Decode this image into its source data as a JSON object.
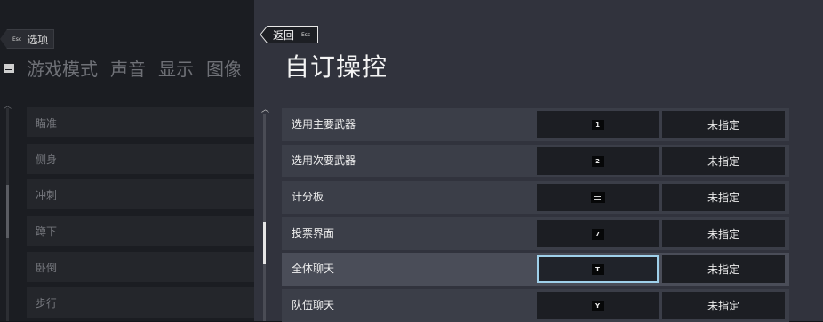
{
  "background": {
    "back": {
      "esc": "Esc",
      "label": "选项"
    },
    "tabs": [
      "游戏模式",
      "声音",
      "显示",
      "图像"
    ],
    "rows": [
      "瞄准",
      "侧身",
      "冲刺",
      "蹲下",
      "卧倒",
      "步行"
    ]
  },
  "header": {
    "back_label": "返回",
    "back_esc": "Esc",
    "title": "自订操控"
  },
  "bindings": [
    {
      "name": "选用主要武器",
      "key": "1",
      "secondary": "未指定"
    },
    {
      "name": "选用次要武器",
      "key": "2",
      "secondary": "未指定"
    },
    {
      "name": "计分板",
      "key": "",
      "key_icon": "tab-key-icon",
      "secondary": "未指定"
    },
    {
      "name": "投票界面",
      "key": "7",
      "secondary": "未指定"
    },
    {
      "name": "全体聊天",
      "key": "T",
      "secondary": "未指定",
      "selected": true
    },
    {
      "name": "队伍聊天",
      "key": "Y",
      "secondary": "未指定"
    }
  ],
  "colors": {
    "focus": "#9fd0ea",
    "panel": "#31333d",
    "row": "#3b3e48"
  }
}
